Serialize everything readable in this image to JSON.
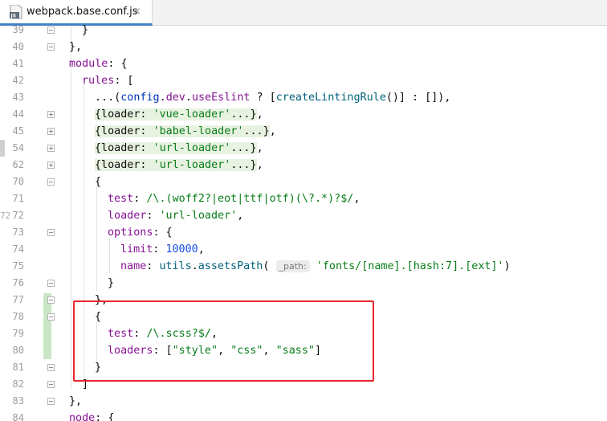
{
  "tab": {
    "icon_label": "JS",
    "title": "webpack.base.conf.js",
    "close": "×"
  },
  "line_numbers": [
    "39",
    "40",
    "41",
    "42",
    "43",
    "44",
    "45",
    "54",
    "62",
    "70",
    "71",
    "72",
    "73",
    "74",
    "75",
    "76",
    "77",
    "78",
    "79",
    "80",
    "81",
    "82",
    "83",
    "84"
  ],
  "code": {
    "l39": "}",
    "l40": "},",
    "l41_key": "module",
    "l41_rest": ": {",
    "l42_key": "rules",
    "l42_rest": ": [",
    "l43_a": "...(",
    "l43_b": "config",
    "l43_c": ".",
    "l43_d": "dev",
    "l43_e": ".",
    "l43_f": "useEslint",
    "l43_g": " ? [",
    "l43_h": "createLintingRule",
    "l43_i": "()] : []),",
    "l44_a": "{loader: ",
    "l44_b": "'vue-loader'",
    "l44_c": "...}",
    "l44_d": ",",
    "l45_a": "{loader: ",
    "l45_b": "'babel-loader'",
    "l45_c": "...}",
    "l45_d": ",",
    "l54_a": "{loader: ",
    "l54_b": "'url-loader'",
    "l54_c": "...}",
    "l54_d": ",",
    "l62_a": "{loader: ",
    "l62_b": "'url-loader'",
    "l62_c": "...}",
    "l62_d": ",",
    "l70": "{",
    "l71_key": "test",
    "l71_a": ": ",
    "l71_b": "/\\.(woff2?|eot|ttf|otf)(\\?.*)?$/",
    "l71_c": ",",
    "l72_key": "loader",
    "l72_a": ": ",
    "l72_b": "'url-loader'",
    "l72_c": ",",
    "l73_key": "options",
    "l73_a": ": {",
    "l74_key": "limit",
    "l74_a": ": ",
    "l74_b": "10000",
    "l74_c": ",",
    "l75_key": "name",
    "l75_a": ": ",
    "l75_b": "utils",
    "l75_c": ".",
    "l75_d": "assetsPath",
    "l75_e": "( ",
    "l75_hint": "_path:",
    "l75_f": " 'fonts/[name].[hash:7].[ext]'",
    "l75_g": ")",
    "l76": "}",
    "l77": "},",
    "l78": "{",
    "l79_key": "test",
    "l79_a": ": ",
    "l79_b": "/\\.scss?$/",
    "l79_c": ",",
    "l80_key": "loaders",
    "l80_a": ": [",
    "l80_b": "\"style\"",
    "l80_c": ", ",
    "l80_d": "\"css\"",
    "l80_e": ", ",
    "l80_f": "\"sass\"",
    "l80_g": "]",
    "l81": "}",
    "l82": "]",
    "l83": "},",
    "l84_key": "node",
    "l84_rest": ": {"
  },
  "left_marker": "72",
  "colors": {
    "keyword": "#0033b3",
    "property": "#871094",
    "string": "#067d17",
    "number": "#1750eb",
    "function": "#00627a",
    "highlight": "#e8262a",
    "vcs_added": "#c9e7c4"
  }
}
